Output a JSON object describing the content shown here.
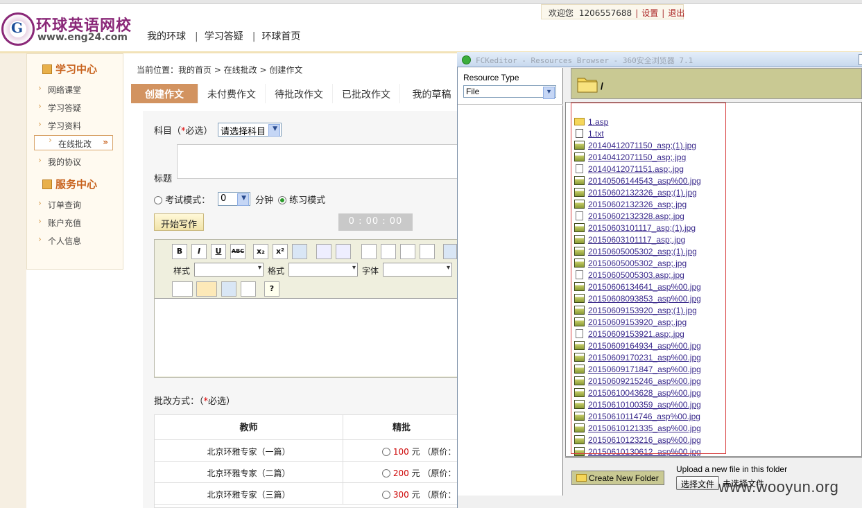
{
  "site": {
    "logo_letter": "G",
    "title": "环球英语网校",
    "url": "www.eng24.com",
    "nav": [
      "我的环球",
      "学习答疑",
      "环球首页"
    ],
    "welcome": "欢迎您",
    "user_id": "1206557688",
    "settings": "设置",
    "logout": "退出"
  },
  "sidebar": {
    "study_center": "学习中心",
    "study_items": [
      "网络课堂",
      "学习答疑",
      "学习资料",
      "在线批改",
      "我的协议"
    ],
    "service_center": "服务中心",
    "service_items": [
      "订单查询",
      "账户充值",
      "个人信息"
    ],
    "active_arrow": "»"
  },
  "main": {
    "breadcrumb": "当前位置：我的首页 > 在线批改 > 创建作文",
    "tabs": [
      "创建作文",
      "未付费作文",
      "待批改作文",
      "已批改作文",
      "我的草稿"
    ],
    "subject_label": "科目（",
    "required_mark": "*",
    "required_text": "必选）",
    "subject_select": "请选择科目",
    "title_label": "标题",
    "exam_mode": "考试模式：",
    "minutes_value": "0",
    "minutes_label": "分钟",
    "practice_mode": "练习模式",
    "start_button": "开始写作",
    "timer": "0 : 00 : 00",
    "editor": {
      "style_label": "样式",
      "format_label": "格式",
      "font_label": "字体",
      "buttons": [
        "B",
        "I",
        "U",
        "ABC",
        "x₂",
        "x²"
      ]
    },
    "correction_label": "批改方式：（",
    "correction_required": "必选）",
    "table": {
      "headers": [
        "教师",
        "精批"
      ],
      "rows": [
        {
          "teacher": "北京环雅专家（一篇）",
          "price": "100",
          "unit": "元 （原价："
        },
        {
          "teacher": "北京环雅专家（二篇）",
          "price": "200",
          "unit": "元 （原价："
        },
        {
          "teacher": "北京环雅专家（三篇）",
          "price": "300",
          "unit": "元 （原价："
        }
      ]
    }
  },
  "popup": {
    "title": "FCKeditor - Resources Browser - 360安全浏览器 7.1",
    "resource_type_label": "Resource Type",
    "resource_type_value": "File",
    "current_path": "/",
    "files": [
      {
        "name": "1.asp",
        "icon": "folder-icon"
      },
      {
        "name": "1.txt",
        "icon": "text-file-icon"
      },
      {
        "name": "20140412071150_asp;(1).jpg",
        "icon": "jpg-file-icon"
      },
      {
        "name": "20140412071150_asp;.jpg",
        "icon": "jpg-file-icon"
      },
      {
        "name": "20140412071151.asp;.jpg",
        "icon": "blank-file-icon"
      },
      {
        "name": "20140506144543_asp%00.jpg",
        "icon": "jpg-file-icon"
      },
      {
        "name": "20150602132326_asp;(1).jpg",
        "icon": "jpg-file-icon"
      },
      {
        "name": "20150602132326_asp;.jpg",
        "icon": "jpg-file-icon"
      },
      {
        "name": "20150602132328.asp;.jpg",
        "icon": "blank-file-icon"
      },
      {
        "name": "20150603101117_asp;(1).jpg",
        "icon": "jpg-file-icon"
      },
      {
        "name": "20150603101117_asp;.jpg",
        "icon": "jpg-file-icon"
      },
      {
        "name": "20150605005302_asp;(1).jpg",
        "icon": "jpg-file-icon"
      },
      {
        "name": "20150605005302_asp;.jpg",
        "icon": "jpg-file-icon"
      },
      {
        "name": "20150605005303.asp;.jpg",
        "icon": "blank-file-icon"
      },
      {
        "name": "20150606134641_asp%00.jpg",
        "icon": "jpg-file-icon"
      },
      {
        "name": "20150608093853_asp%00.jpg",
        "icon": "jpg-file-icon"
      },
      {
        "name": "20150609153920_asp;(1).jpg",
        "icon": "jpg-file-icon"
      },
      {
        "name": "20150609153920_asp;.jpg",
        "icon": "jpg-file-icon"
      },
      {
        "name": "20150609153921.asp;.jpg",
        "icon": "blank-file-icon"
      },
      {
        "name": "20150609164934_asp%00.jpg",
        "icon": "jpg-file-icon"
      },
      {
        "name": "20150609170231_asp%00.jpg",
        "icon": "jpg-file-icon"
      },
      {
        "name": "20150609171847_asp%00.jpg",
        "icon": "jpg-file-icon"
      },
      {
        "name": "20150609215246_asp%00.jpg",
        "icon": "jpg-file-icon"
      },
      {
        "name": "20150610043628_asp%00.jpg",
        "icon": "jpg-file-icon"
      },
      {
        "name": "20150610100359_asp%00.jpg",
        "icon": "jpg-file-icon"
      },
      {
        "name": "20150610114746_asp%00.jpg",
        "icon": "jpg-file-icon"
      },
      {
        "name": "20150610121335_asp%00.jpg",
        "icon": "jpg-file-icon"
      },
      {
        "name": "20150610123216_asp%00.jpg",
        "icon": "jpg-file-icon"
      },
      {
        "name": "20150610130612_asp%00.jpg",
        "icon": "jpg-file-icon"
      }
    ],
    "create_folder_button": "Create New Folder",
    "upload_label": "Upload a new file in this folder",
    "choose_file_button": "选择文件",
    "no_file_text": "未选择文件"
  },
  "watermark": "www.wooyun.org",
  "colors": {
    "brand": "#8a2878",
    "accent": "#d29360",
    "sidebar_heading": "#c8621d",
    "path_bar": "#c9c993",
    "highlight_box": "#d84040"
  }
}
